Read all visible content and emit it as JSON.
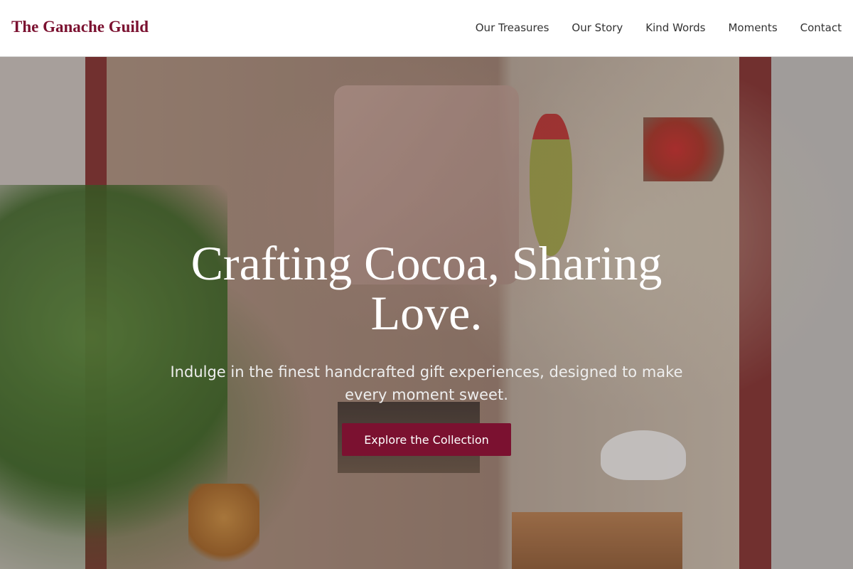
{
  "header": {
    "brand": "The Ganache Guild",
    "nav": [
      "Our Treasures",
      "Our Story",
      "Kind Words",
      "Moments",
      "Contact"
    ]
  },
  "hero": {
    "title": "Crafting Cocoa, Sharing Love.",
    "subtitle": "Indulge in the finest handcrafted gift experiences, designed to make every moment sweet.",
    "cta_label": "Explore the Collection"
  },
  "colors": {
    "brand": "#7b1130",
    "nav_text": "#333333",
    "hero_text": "#ffffff"
  }
}
